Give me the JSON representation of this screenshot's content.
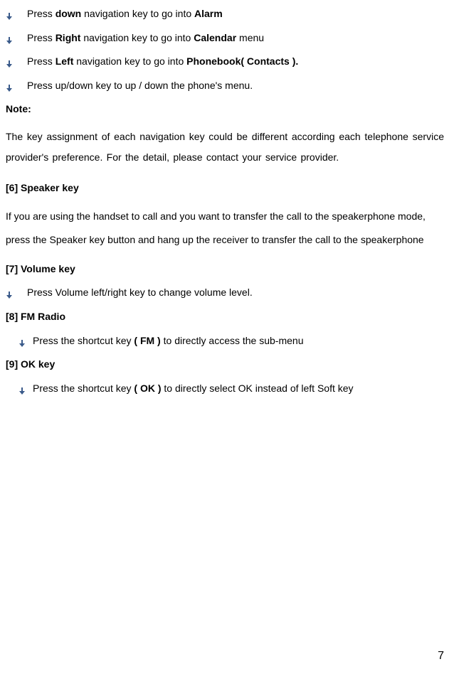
{
  "bullets_top": [
    {
      "pre": "Press ",
      "b1": "down",
      "mid1": " navigation key to go into ",
      "b2": "Alarm",
      "post": ""
    },
    {
      "pre": "Press ",
      "b1": "Right",
      "mid1": " navigation key to go into ",
      "b2": "Calendar",
      "post": " menu"
    },
    {
      "pre": "Press ",
      "b1": "Left",
      "mid1": " navigation key to go into ",
      "b2": "Phonebook( Contacts ).",
      "post": ""
    },
    {
      "pre": "Press up/down key to up / down the phone's menu.",
      "b1": "",
      "mid1": "",
      "b2": "",
      "post": ""
    }
  ],
  "note_label": "Note:",
  "note_para": "The key assignment of each navigation key could be different according each telephone service provider's preference. For the detail, please contact your service provider.",
  "s6": {
    "heading": "[6]  Speaker key",
    "body": "If you are using the handset to call and you want to transfer the call to the speakerphone mode, press the Speaker key button and hang up the receiver to transfer the call to the speakerphone"
  },
  "s7": {
    "heading": "[7]  Volume key",
    "bullet": "Press Volume left/right key to change volume level."
  },
  "s8": {
    "heading": "[8]  FM Radio",
    "bullet_pre": "Press the shortcut key ",
    "bullet_bold": "( FM )",
    "bullet_post": " to directly access the sub-menu"
  },
  "s9": {
    "heading": "[9]  OK key",
    "bullet_pre": "Press the shortcut key ",
    "bullet_bold": "( OK )",
    "bullet_post": " to directly select OK instead of left Soft key"
  },
  "page_number": "7"
}
